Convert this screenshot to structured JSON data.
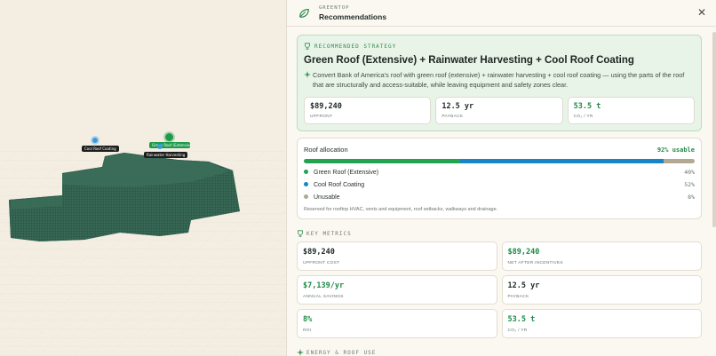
{
  "viewport": {
    "markers": [
      {
        "label": "Cool Roof Coating",
        "color": "#3b9be0"
      },
      {
        "label": "Green Roof (Extensive)",
        "color": "#1f9a4b"
      },
      {
        "label": "Rainwater Harvesting",
        "color": "#1d1d1d"
      }
    ]
  },
  "panel": {
    "brand": "GREENTOP",
    "title": "Recommendations",
    "close_icon": "close-icon"
  },
  "strategy": {
    "eyebrow": "RECOMMENDED STRATEGY",
    "title": "Green Roof (Extensive) + Rainwater Harvesting + Cool Roof Coating",
    "description": "Convert Bank of America's roof with green roof (extensive) + rainwater harvesting + cool roof coating — using the parts of the roof that are structurally and access-suitable, while leaving equipment and safety zones clear.",
    "stats": [
      {
        "value": "$89,240",
        "label": "UPFRONT",
        "green": false
      },
      {
        "value": "12.5 yr",
        "label": "PAYBACK",
        "green": false
      },
      {
        "value": "53.5 t",
        "label": "CO₂ / YR",
        "green": true
      }
    ]
  },
  "allocation": {
    "title": "Roof allocation",
    "usable": "92% usable",
    "segments": [
      {
        "name": "Green Roof (Extensive)",
        "pct_label": "40%",
        "fraction": 0.4,
        "color": "#21a34f"
      },
      {
        "name": "Cool Roof Coating",
        "pct_label": "52%",
        "fraction": 0.52,
        "color": "#1786c8"
      },
      {
        "name": "Unusable",
        "pct_label": "8%",
        "fraction": 0.08,
        "color": "#b3a892"
      }
    ],
    "note": "Reserved for rooftop HVAC, vents and equipment, roof setbacks, walkways and drainage."
  },
  "key_metrics": {
    "heading": "KEY METRICS",
    "items": [
      {
        "value": "$89,240",
        "label": "UPFRONT COST",
        "green": false
      },
      {
        "value": "$89,240",
        "label": "NET AFTER INCENTIVES",
        "green": true
      },
      {
        "value": "$7,139/yr",
        "label": "ANNUAL SAVINGS",
        "green": true
      },
      {
        "value": "12.5 yr",
        "label": "PAYBACK",
        "green": false
      },
      {
        "value": "8%",
        "label": "ROI",
        "green": true
      },
      {
        "value": "53.5 t",
        "label": "CO₂ / YR",
        "green": true
      }
    ]
  },
  "energy": {
    "heading": "ENERGY & ROOF USE"
  }
}
